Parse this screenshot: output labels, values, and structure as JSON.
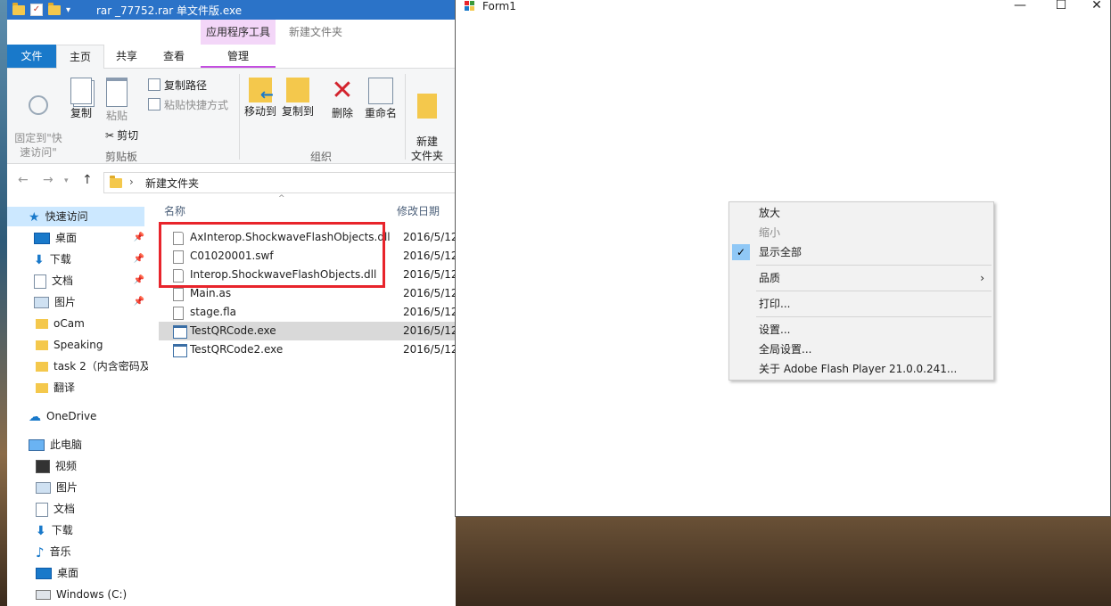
{
  "explorer": {
    "window_title": "rar        _77752.rar   单文件版.exe",
    "contextual_tab_group": "应用程序工具",
    "contextual_tab_group2": "新建文件夹",
    "tabs": {
      "file": "文件",
      "home": "主页",
      "share": "共享",
      "view": "查看",
      "manage": "管理"
    },
    "ribbon": {
      "pin_quick": "固定到\"快\n速访问\"",
      "copy": "复制",
      "paste": "粘贴",
      "copy_path": "复制路径",
      "paste_shortcut": "粘贴快捷方式",
      "cut": "剪切",
      "clipboard_group": "剪贴板",
      "move_to": "移动到",
      "copy_to": "复制到",
      "delete": "删除",
      "rename": "重命名",
      "organize_group": "组织",
      "new_folder": "新建\n文件夹"
    },
    "address": {
      "crumb": "新建文件夹"
    },
    "nav": {
      "quick_access": "快速访问",
      "items": [
        "桌面",
        "下载",
        "文档",
        "图片",
        "oCam",
        "Speaking",
        "task 2（内含密码及",
        "翻译"
      ],
      "onedrive": "OneDrive",
      "this_pc": "此电脑",
      "pc_items": [
        "视频",
        "图片",
        "文档",
        "下载",
        "音乐",
        "桌面",
        "Windows (C:)"
      ]
    },
    "columns": {
      "name": "名称",
      "date": "修改日期"
    },
    "files": [
      {
        "name": "AxInterop.ShockwaveFlashObjects.dll",
        "date": "2016/5/12"
      },
      {
        "name": "C01020001.swf",
        "date": "2016/5/12"
      },
      {
        "name": "Interop.ShockwaveFlashObjects.dll",
        "date": "2016/5/12"
      },
      {
        "name": "Main.as",
        "date": "2016/5/12"
      },
      {
        "name": "stage.fla",
        "date": "2016/5/12"
      },
      {
        "name": "TestQRCode.exe",
        "date": "2016/5/12"
      },
      {
        "name": "TestQRCode2.exe",
        "date": "2016/5/12"
      }
    ]
  },
  "form1": {
    "title": "Form1",
    "controls": {
      "minimize": "—",
      "maximize": "☐",
      "close": "✕"
    }
  },
  "context_menu": {
    "zoom_in": "放大",
    "zoom_out": "缩小",
    "show_all": "显示全部",
    "quality": "品质",
    "print": "打印...",
    "settings": "设置...",
    "global_settings": "全局设置...",
    "about": "关于 Adobe Flash Player 21.0.0.241..."
  },
  "colors": {
    "accent": "#1979ca",
    "highlight_box": "#e8242b",
    "manage_tab": "#f3d6f8"
  }
}
